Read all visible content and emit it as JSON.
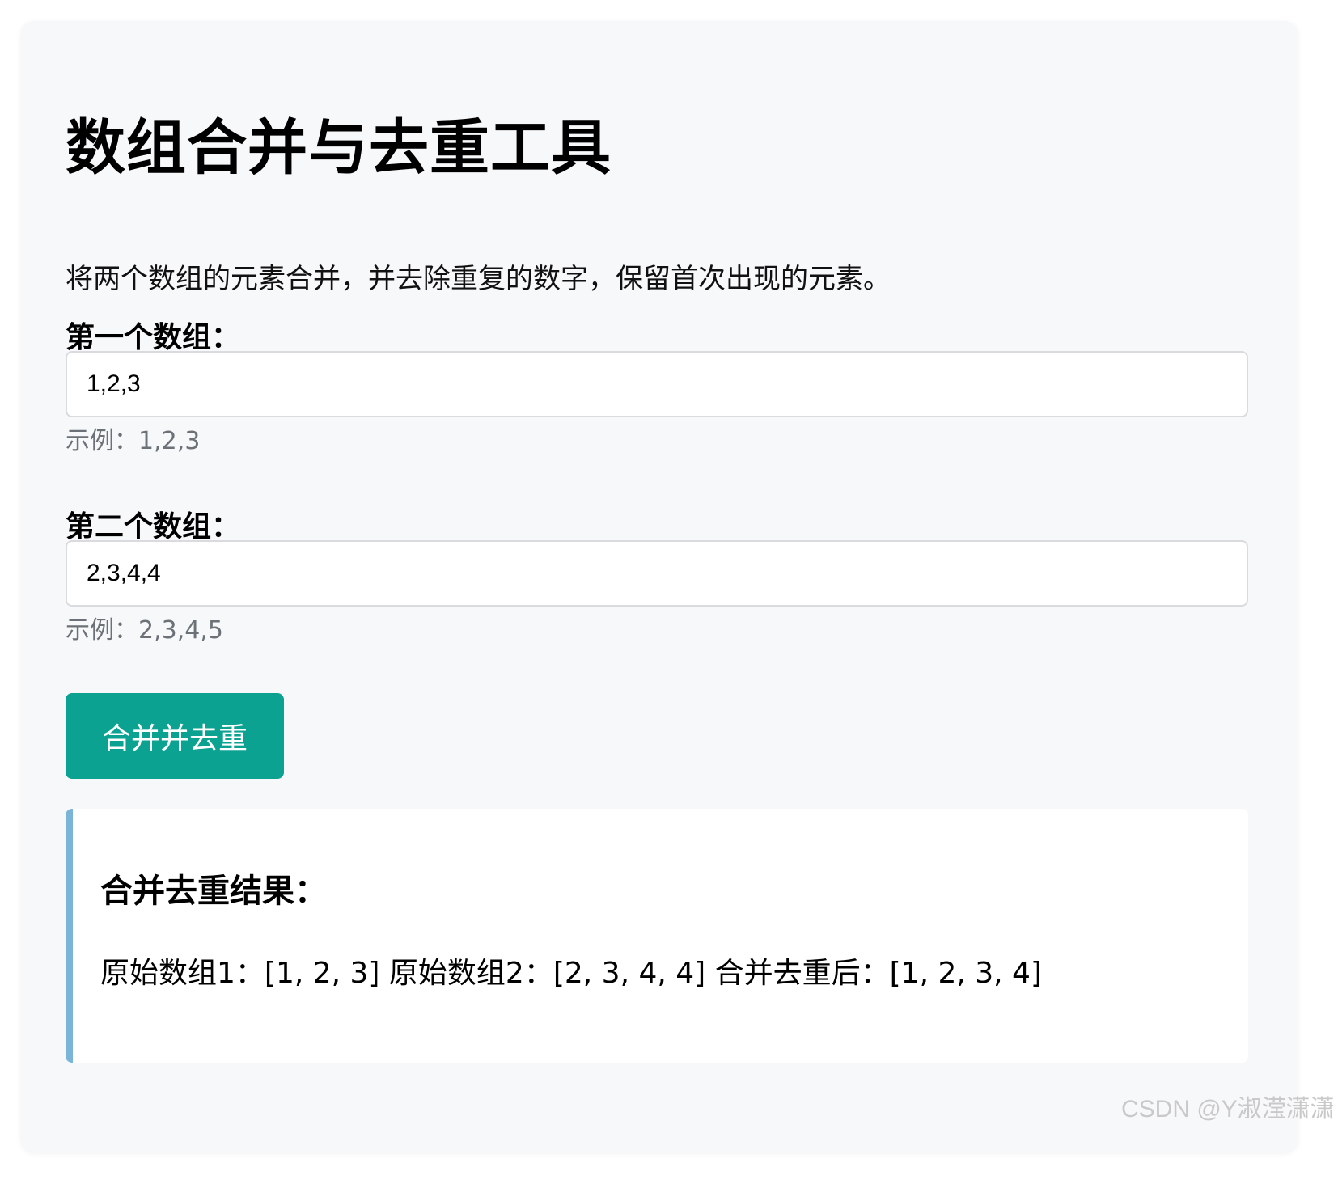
{
  "tool": {
    "title": "数组合并与去重工具",
    "description": "将两个数组的元素合并，并去除重复的数字，保留首次出现的元素。"
  },
  "array1": {
    "label": "第一个数组：",
    "value": "1,2,3",
    "hint": "示例：1,2,3"
  },
  "array2": {
    "label": "第二个数组：",
    "value": "2,3,4,4",
    "hint": "示例：2,3,4,5"
  },
  "actions": {
    "merge_label": "合并并去重"
  },
  "result": {
    "title": "合并去重结果：",
    "text": "原始数组1：[1, 2, 3] 原始数组2：[2, 3, 4, 4] 合并去重后：[1, 2, 3, 4]"
  },
  "watermark": "CSDN @Y淑滢潇潇",
  "colors": {
    "button_bg": "#0ca292",
    "result_accent": "#7ab4d9",
    "card_bg": "#f7f8fa",
    "hint_text": "#6b7177"
  }
}
